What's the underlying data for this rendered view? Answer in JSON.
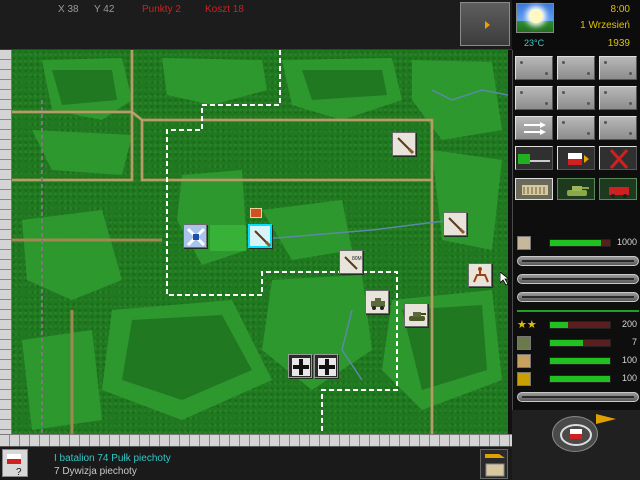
{
  "topbar": {
    "x_label": "X 38",
    "y_label": "Y 42",
    "points_label": "Punkty 2",
    "cost_label": "Koszt 18"
  },
  "weather": {
    "time": "8:00",
    "date": "1 Wrzesień",
    "year": "1939",
    "temperature": "23°C",
    "condition_icon": "sun-icon"
  },
  "map": {
    "units": [
      {
        "name": "infantry-unit",
        "icon": "rifle-icon",
        "selected": false
      },
      {
        "name": "infantry-unit",
        "icon": "rifle-icon",
        "selected": false
      },
      {
        "name": "selected-infantry-unit",
        "icon": "rifle-icon",
        "selected": true
      },
      {
        "name": "hq-unit",
        "icon": "crossed-hq-icon",
        "selected": false
      },
      {
        "name": "artillery-unit",
        "icon": "mortar-icon",
        "selected": false
      },
      {
        "name": "cavalry-unit",
        "icon": "horse-rider-icon",
        "selected": false
      },
      {
        "name": "armored-car-unit",
        "icon": "armored-car-icon",
        "selected": false
      },
      {
        "name": "tank-unit",
        "icon": "tank-icon",
        "selected": false
      },
      {
        "name": "german-unit",
        "icon": "balkenkreuz-icon",
        "selected": false
      },
      {
        "name": "german-unit",
        "icon": "balkenkreuz-icon",
        "selected": false
      }
    ],
    "artillery_label": "80M"
  },
  "panel": {
    "tabs": [
      "infantry-tab",
      "tank-tab",
      "train-tab"
    ],
    "stats": {
      "strength": {
        "value": "1000",
        "fill": 0.85
      },
      "experience": {
        "value": "200",
        "fill": 0.3
      },
      "men": {
        "value": "7",
        "fill": 0.55
      },
      "morale": {
        "value": "100",
        "fill": 1.0
      },
      "supply": {
        "value": "100",
        "fill": 1.0
      }
    }
  },
  "status": {
    "unit_line1": "I batalion 74 Pułk piechoty",
    "unit_line2": "7 Dywizja piechoty"
  }
}
